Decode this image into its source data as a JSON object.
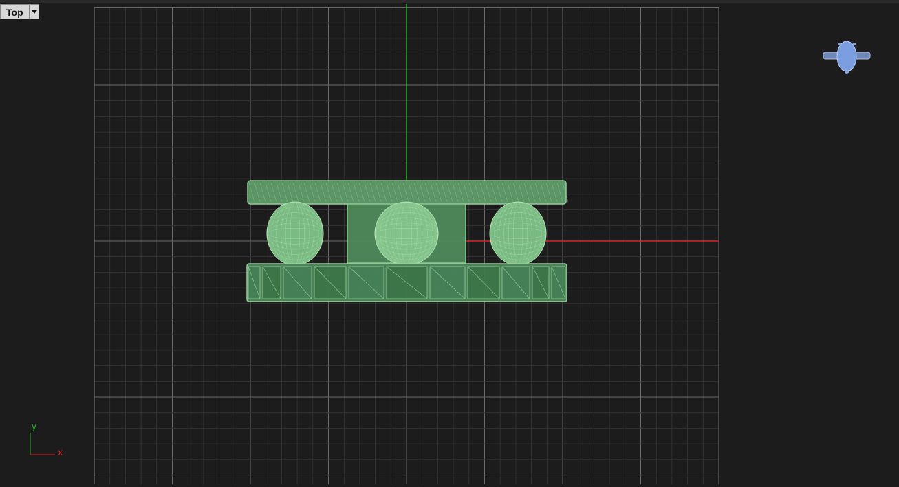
{
  "viewport": {
    "view_name": "Top",
    "colors": {
      "background": "#1c1c1c",
      "grid_minor": "#3a3a3a",
      "grid_major": "#6a6a6a",
      "x_axis": "#e02020",
      "y_axis": "#20b020",
      "model_fill": "#6fae78",
      "model_edge": "#9fd6a4",
      "gumball": "#7b9ee0"
    }
  },
  "axis_indicator": {
    "x_label": "x",
    "y_label": "y"
  },
  "icons": {
    "view_menu": "chevron-down-icon",
    "nav_widget": "drone-icon"
  }
}
